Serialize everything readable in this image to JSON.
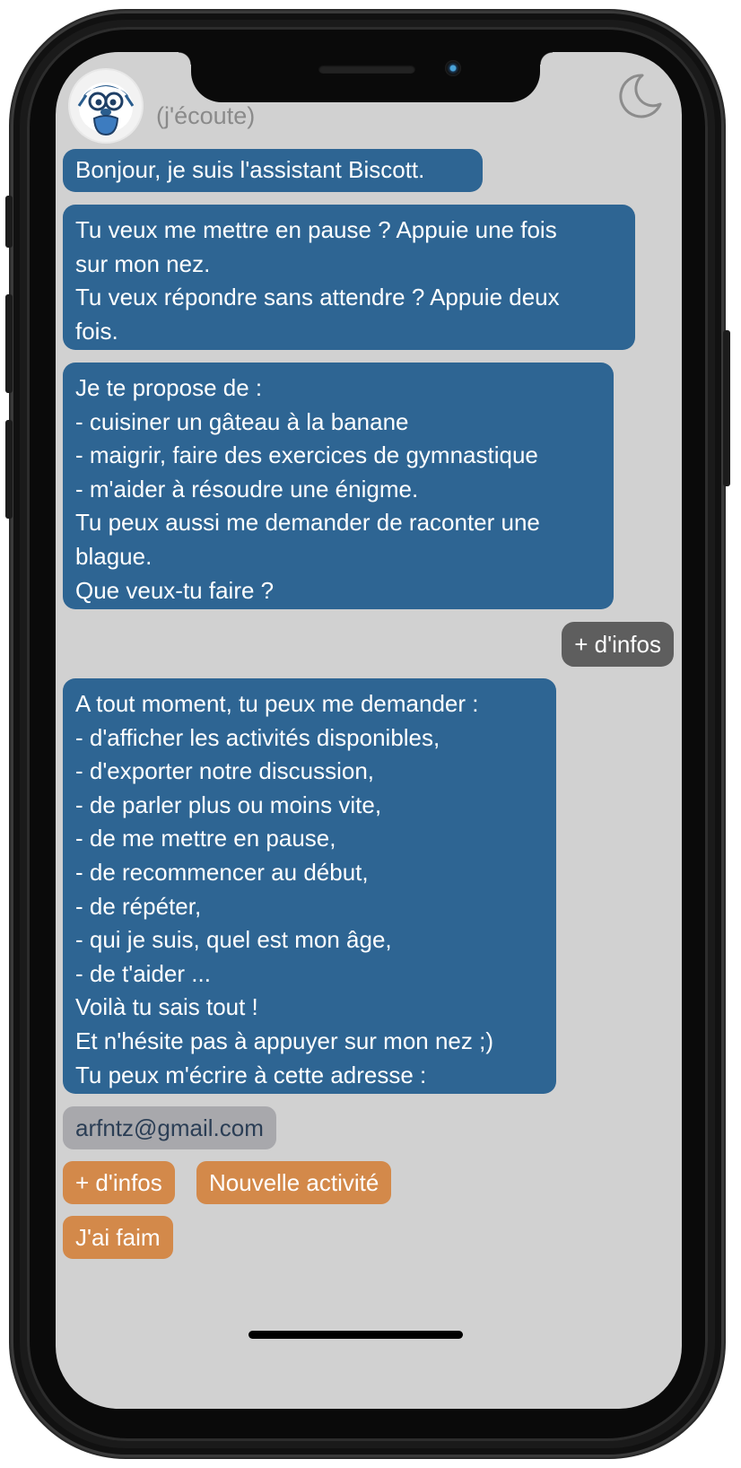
{
  "header": {
    "status": "(j'écoute)",
    "avatar_icon": "biscott-mascot-icon",
    "theme_icon": "moon-icon"
  },
  "messages": [
    {
      "from": "bot",
      "lines": [
        "Bonjour, je suis l'assistant Biscott."
      ]
    },
    {
      "from": "bot",
      "lines": [
        "Tu veux me mettre en pause ? Appuie une fois",
        "sur mon nez.",
        "Tu veux répondre sans attendre ? Appuie deux",
        "fois."
      ]
    },
    {
      "from": "bot",
      "lines": [
        "Je te propose de :",
        "- cuisiner un gâteau à la banane",
        "- maigrir, faire des exercices de gymnastique",
        "- m'aider à résoudre une énigme.",
        "Tu peux aussi me demander de raconter une",
        "blague.",
        "Que veux-tu faire ?"
      ]
    },
    {
      "from": "user",
      "text": "+ d'infos"
    },
    {
      "from": "bot",
      "lines": [
        "A tout moment, tu peux me demander :",
        "- d'afficher les activités disponibles,",
        "- d'exporter notre discussion,",
        "- de parler plus ou moins vite,",
        "- de me mettre en pause,",
        "- de recommencer au début,",
        "- de répéter,",
        "- qui je suis, quel est mon âge,",
        "- de t'aider ...",
        "Voilà tu sais tout !",
        "Et n'hésite pas à appuyer sur mon nez ;)",
        "Tu peux m'écrire à cette adresse :"
      ]
    }
  ],
  "email": "arfntz@gmail.com",
  "quick_replies": [
    "+ d'infos",
    "Nouvelle activité",
    "J'ai faim"
  ],
  "colors": {
    "screen_bg": "#d1d1d1",
    "bot_bubble": "#2e6593",
    "user_bubble": "#5e5e5e",
    "email_bubble": "#a8a8ac",
    "quick_reply": "#d3894a"
  }
}
